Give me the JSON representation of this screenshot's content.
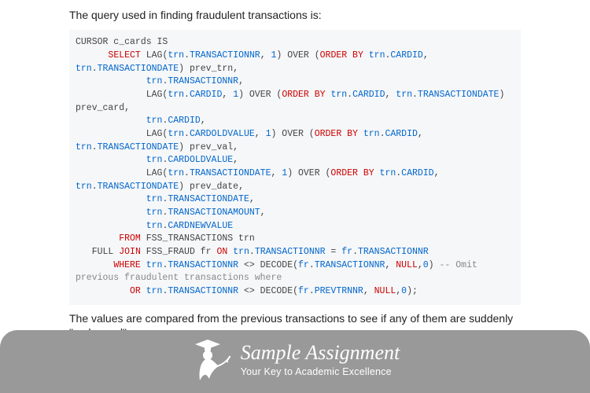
{
  "intro": "The query used in finding fraudulent transactions is:",
  "outro": "The values are compared from the previous transactions to see if any of them are suddenly \"recharged\".",
  "code": {
    "tokens": [
      {
        "t": "CURSOR c_cards IS\n"
      },
      {
        "t": "      ",
        "c": ""
      },
      {
        "t": "SELECT",
        "c": "kw-red"
      },
      {
        "t": " LAG("
      },
      {
        "t": "trn",
        "c": "kw-blue"
      },
      {
        "t": "."
      },
      {
        "t": "TRANSACTIONNR",
        "c": "kw-blue"
      },
      {
        "t": ", "
      },
      {
        "t": "1",
        "c": "kw-blue"
      },
      {
        "t": ") OVER ("
      },
      {
        "t": "ORDER BY",
        "c": "kw-red"
      },
      {
        "t": " "
      },
      {
        "t": "trn",
        "c": "kw-blue"
      },
      {
        "t": "."
      },
      {
        "t": "CARDID",
        "c": "kw-blue"
      },
      {
        "t": ", "
      },
      {
        "t": "trn",
        "c": "kw-blue"
      },
      {
        "t": "."
      },
      {
        "t": "TRANSACTIONDATE",
        "c": "kw-blue"
      },
      {
        "t": ") prev_trn,\n"
      },
      {
        "t": "             "
      },
      {
        "t": "trn",
        "c": "kw-blue"
      },
      {
        "t": "."
      },
      {
        "t": "TRANSACTIONNR",
        "c": "kw-blue"
      },
      {
        "t": ",\n"
      },
      {
        "t": "             LAG("
      },
      {
        "t": "trn",
        "c": "kw-blue"
      },
      {
        "t": "."
      },
      {
        "t": "CARDID",
        "c": "kw-blue"
      },
      {
        "t": ", "
      },
      {
        "t": "1",
        "c": "kw-blue"
      },
      {
        "t": ") OVER ("
      },
      {
        "t": "ORDER BY",
        "c": "kw-red"
      },
      {
        "t": " "
      },
      {
        "t": "trn",
        "c": "kw-blue"
      },
      {
        "t": "."
      },
      {
        "t": "CARDID",
        "c": "kw-blue"
      },
      {
        "t": ", "
      },
      {
        "t": "trn",
        "c": "kw-blue"
      },
      {
        "t": "."
      },
      {
        "t": "TRANSACTIONDATE",
        "c": "kw-blue"
      },
      {
        "t": ") prev_card,\n"
      },
      {
        "t": "             "
      },
      {
        "t": "trn",
        "c": "kw-blue"
      },
      {
        "t": "."
      },
      {
        "t": "CARDID",
        "c": "kw-blue"
      },
      {
        "t": ",\n"
      },
      {
        "t": "             LAG("
      },
      {
        "t": "trn",
        "c": "kw-blue"
      },
      {
        "t": "."
      },
      {
        "t": "CARDOLDVALUE",
        "c": "kw-blue"
      },
      {
        "t": ", "
      },
      {
        "t": "1",
        "c": "kw-blue"
      },
      {
        "t": ") OVER ("
      },
      {
        "t": "ORDER BY",
        "c": "kw-red"
      },
      {
        "t": " "
      },
      {
        "t": "trn",
        "c": "kw-blue"
      },
      {
        "t": "."
      },
      {
        "t": "CARDID",
        "c": "kw-blue"
      },
      {
        "t": ", "
      },
      {
        "t": "trn",
        "c": "kw-blue"
      },
      {
        "t": "."
      },
      {
        "t": "TRANSACTIONDATE",
        "c": "kw-blue"
      },
      {
        "t": ") prev_val,\n"
      },
      {
        "t": "             "
      },
      {
        "t": "trn",
        "c": "kw-blue"
      },
      {
        "t": "."
      },
      {
        "t": "CARDOLDVALUE",
        "c": "kw-blue"
      },
      {
        "t": ",\n"
      },
      {
        "t": "             LAG("
      },
      {
        "t": "trn",
        "c": "kw-blue"
      },
      {
        "t": "."
      },
      {
        "t": "TRANSACTIONDATE",
        "c": "kw-blue"
      },
      {
        "t": ", "
      },
      {
        "t": "1",
        "c": "kw-blue"
      },
      {
        "t": ") OVER ("
      },
      {
        "t": "ORDER BY",
        "c": "kw-red"
      },
      {
        "t": " "
      },
      {
        "t": "trn",
        "c": "kw-blue"
      },
      {
        "t": "."
      },
      {
        "t": "CARDID",
        "c": "kw-blue"
      },
      {
        "t": ", "
      },
      {
        "t": "trn",
        "c": "kw-blue"
      },
      {
        "t": "."
      },
      {
        "t": "TRANSACTIONDATE",
        "c": "kw-blue"
      },
      {
        "t": ") prev_date,\n"
      },
      {
        "t": "             "
      },
      {
        "t": "trn",
        "c": "kw-blue"
      },
      {
        "t": "."
      },
      {
        "t": "TRANSACTIONDATE",
        "c": "kw-blue"
      },
      {
        "t": ",\n"
      },
      {
        "t": "             "
      },
      {
        "t": "trn",
        "c": "kw-blue"
      },
      {
        "t": "."
      },
      {
        "t": "TRANSACTIONAMOUNT",
        "c": "kw-blue"
      },
      {
        "t": ",\n"
      },
      {
        "t": "             "
      },
      {
        "t": "trn",
        "c": "kw-blue"
      },
      {
        "t": "."
      },
      {
        "t": "CARDNEWVALUE",
        "c": "kw-blue"
      },
      {
        "t": "\n"
      },
      {
        "t": "        "
      },
      {
        "t": "FROM",
        "c": "kw-red"
      },
      {
        "t": " FSS_TRANSACTIONS trn\n"
      },
      {
        "t": "   FULL "
      },
      {
        "t": "JOIN",
        "c": "kw-red"
      },
      {
        "t": " FSS_FRAUD fr "
      },
      {
        "t": "ON",
        "c": "kw-red"
      },
      {
        "t": " "
      },
      {
        "t": "trn",
        "c": "kw-blue"
      },
      {
        "t": "."
      },
      {
        "t": "TRANSACTIONNR",
        "c": "kw-blue"
      },
      {
        "t": " = "
      },
      {
        "t": "fr",
        "c": "kw-blue"
      },
      {
        "t": "."
      },
      {
        "t": "TRANSACTIONNR",
        "c": "kw-blue"
      },
      {
        "t": "\n"
      },
      {
        "t": "       "
      },
      {
        "t": "WHERE",
        "c": "kw-red"
      },
      {
        "t": " "
      },
      {
        "t": "trn",
        "c": "kw-blue"
      },
      {
        "t": "."
      },
      {
        "t": "TRANSACTIONNR",
        "c": "kw-blue"
      },
      {
        "t": " <> DECODE("
      },
      {
        "t": "fr",
        "c": "kw-blue"
      },
      {
        "t": "."
      },
      {
        "t": "TRANSACTIONNR",
        "c": "kw-blue"
      },
      {
        "t": ", "
      },
      {
        "t": "NULL",
        "c": "kw-red"
      },
      {
        "t": ","
      },
      {
        "t": "0",
        "c": "kw-blue"
      },
      {
        "t": ") "
      },
      {
        "t": "-- Omit previous fraudulent transactions where",
        "c": "kw-gray"
      },
      {
        "t": "\n"
      },
      {
        "t": "          "
      },
      {
        "t": "OR",
        "c": "kw-red"
      },
      {
        "t": " "
      },
      {
        "t": "trn",
        "c": "kw-blue"
      },
      {
        "t": "."
      },
      {
        "t": "TRANSACTIONNR",
        "c": "kw-blue"
      },
      {
        "t": " <> DECODE("
      },
      {
        "t": "fr",
        "c": "kw-blue"
      },
      {
        "t": "."
      },
      {
        "t": "PREVTRNNR",
        "c": "kw-blue"
      },
      {
        "t": ", "
      },
      {
        "t": "NULL",
        "c": "kw-red"
      },
      {
        "t": ","
      },
      {
        "t": "0",
        "c": "kw-blue"
      },
      {
        "t": ");"
      }
    ]
  },
  "brand": {
    "name": "Sample Assignment",
    "tagline": "Your Key to Academic Excellence"
  }
}
